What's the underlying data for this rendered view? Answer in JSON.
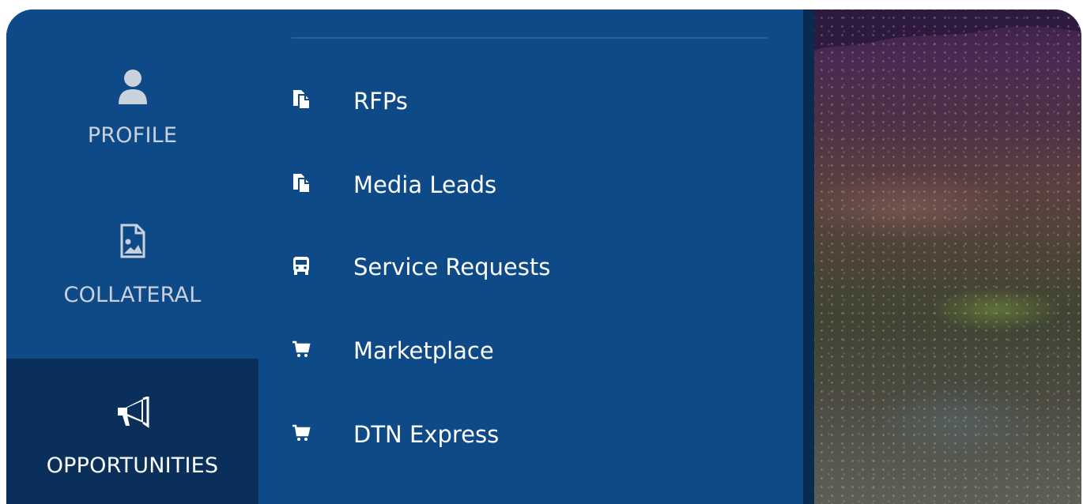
{
  "rail": {
    "items": [
      {
        "label": "PROFILE",
        "icon": "user-icon",
        "active": false
      },
      {
        "label": "COLLATERAL",
        "icon": "image-file-icon",
        "active": false
      },
      {
        "label": "OPPORTUNITIES",
        "icon": "megaphone-icon",
        "active": true
      }
    ]
  },
  "submenu": {
    "items": [
      {
        "label": "RFPs",
        "icon": "documents-icon"
      },
      {
        "label": "Media Leads",
        "icon": "documents-icon"
      },
      {
        "label": "Service Requests",
        "icon": "bus-icon"
      },
      {
        "label": "Marketplace",
        "icon": "cart-icon"
      },
      {
        "label": "DTN Express",
        "icon": "cart-icon"
      }
    ]
  },
  "colors": {
    "panel": "#0e4a88",
    "active_rail": "#0a2f5a",
    "separator": "#072c50",
    "rail_text": "#c9d1dc",
    "menu_text": "#ffffff"
  }
}
